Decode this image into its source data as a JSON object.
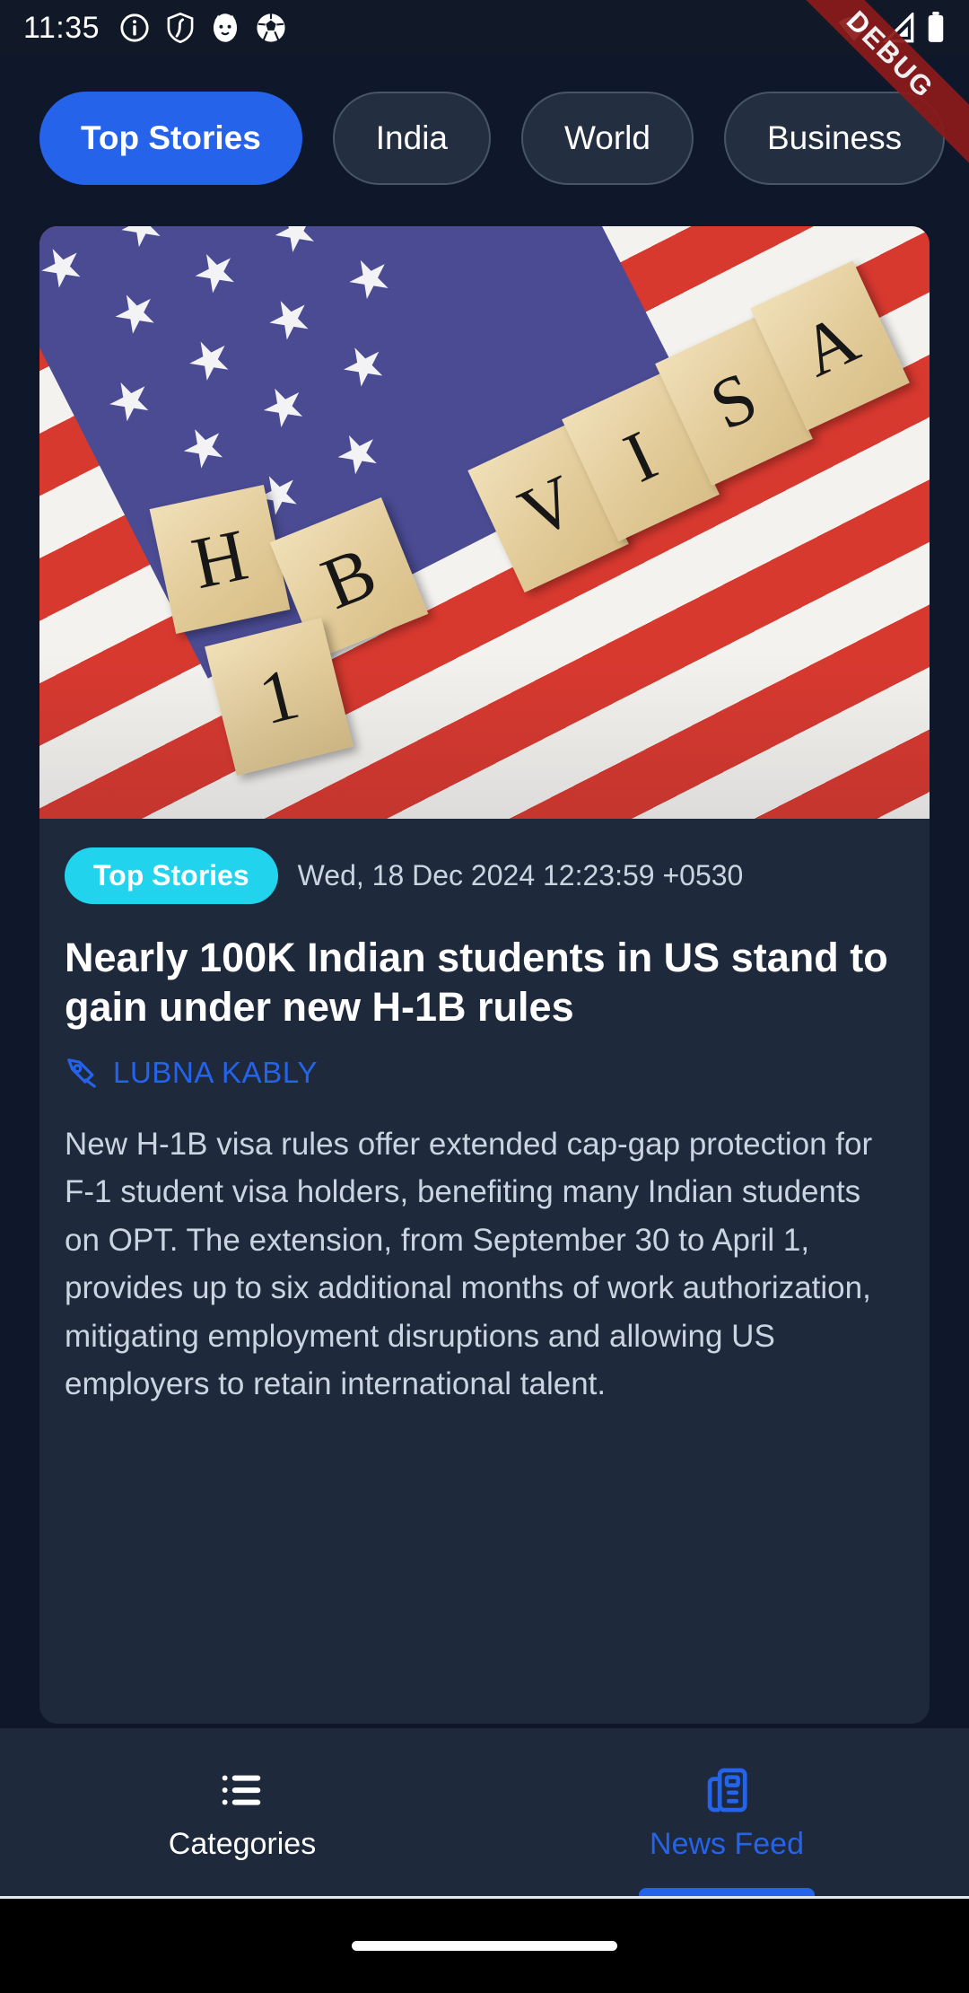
{
  "status_bar": {
    "clock": "11:35",
    "left_icons": [
      "info-icon",
      "shield-icon",
      "cat-app-icon",
      "football-icon"
    ],
    "right_icons": [
      "wifi-icon",
      "cellular-signal-icon",
      "battery-icon"
    ]
  },
  "debug_ribbon": {
    "label": "DEBUG",
    "color": "#8B1A1A"
  },
  "tabs": [
    {
      "label": "Top Stories",
      "active": true
    },
    {
      "label": "India",
      "active": false
    },
    {
      "label": "World",
      "active": false
    },
    {
      "label": "Business",
      "active": false
    }
  ],
  "article": {
    "image_alt": "US flag with wooden scrabble tiles spelling H1B VISA",
    "image_tiles": [
      "H",
      "B",
      "1",
      "V",
      "I",
      "S",
      "A"
    ],
    "category": "Top Stories",
    "timestamp": "Wed, 18 Dec 2024 12:23:59 +0530",
    "headline": "Nearly 100K Indian students in US stand to gain under new H-1B rules",
    "author": "LUBNA KABLY",
    "author_icon": "pen-nib-icon",
    "summary": "New H-1B visa rules offer extended cap-gap protection for F-1 student visa holders, benefiting many Indian students on OPT. The extension, from September 30 to April 1, provides up to six additional months of work authorization, mitigating employment disruptions and allowing US employers to retain international talent."
  },
  "bottom_nav": [
    {
      "label": "Categories",
      "icon": "list-icon",
      "active": false
    },
    {
      "label": "News Feed",
      "icon": "newspaper-icon",
      "active": true
    }
  ],
  "colors": {
    "page_background": "#0F172A",
    "card_background": "#1E293B",
    "accent_blue": "#2563EB",
    "badge_cyan": "#22D3EE",
    "body_text": "#CBD5E1",
    "status_bar_background": "#111827"
  }
}
